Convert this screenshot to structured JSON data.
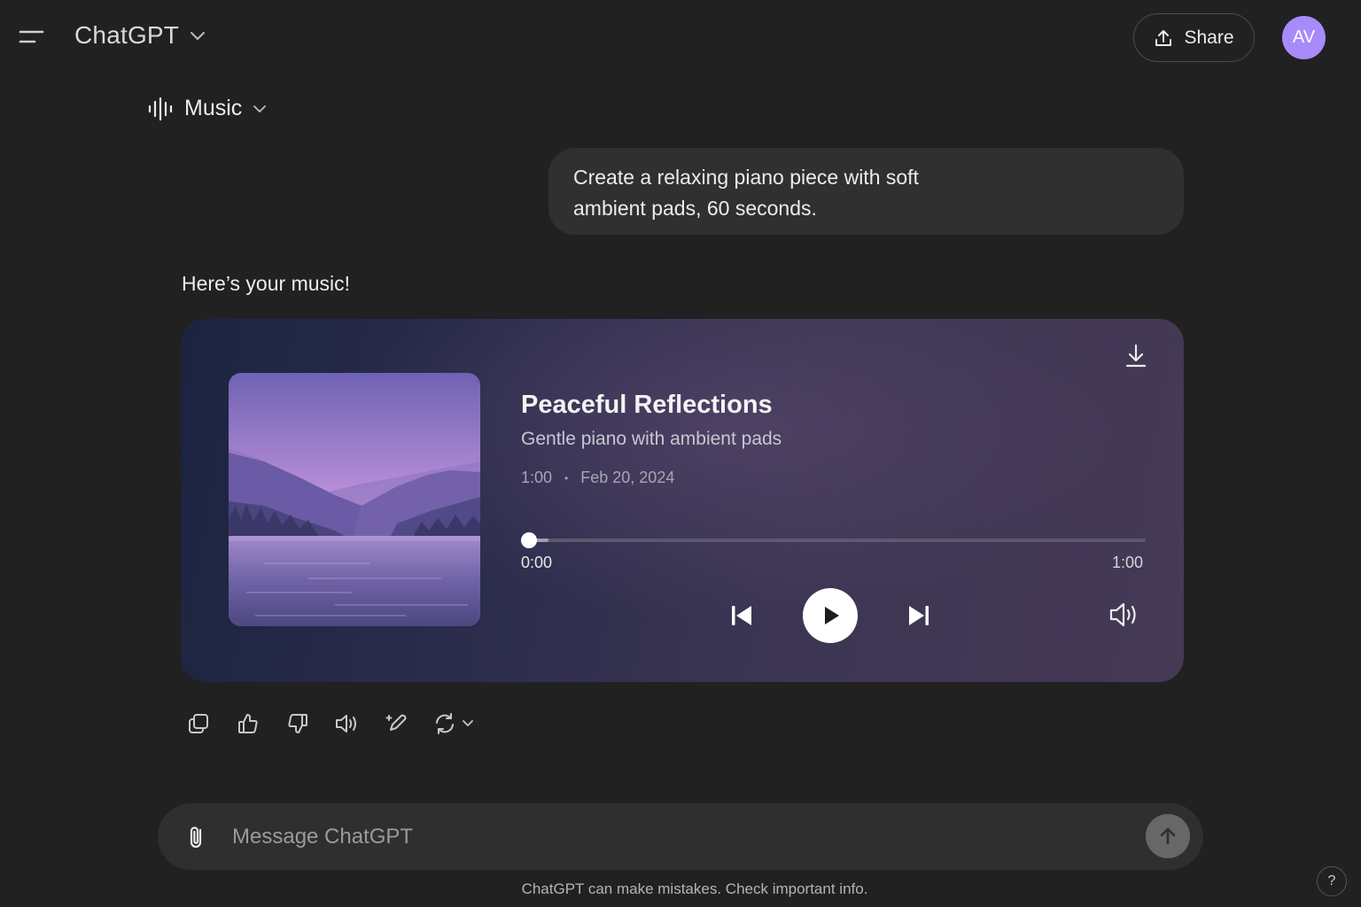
{
  "header": {
    "app_title": "ChatGPT",
    "share_label": "Share",
    "avatar_initials": "AV",
    "avatar_color": "#a78bfa"
  },
  "model_selector": {
    "label": "Music",
    "icon": "waveform-icon"
  },
  "conversation": {
    "user_message_lines": [
      "Create a relaxing piano piece with soft",
      "ambient pads, 60 seconds."
    ],
    "assistant_intro": "Here’s your music!"
  },
  "music_card": {
    "title": "Peaceful Reflections",
    "subtitle": "Gentle piano with ambient pads",
    "duration": "1:00",
    "date": "Feb 20, 2024",
    "progress": 0.0,
    "time_current": "0:00",
    "time_total": "1:00",
    "icons": [
      "download-icon",
      "skip-previous-icon",
      "play-icon",
      "skip-next-icon",
      "volume-icon"
    ]
  },
  "actions": {
    "icons": [
      "copy-icon",
      "thumbs-up-icon",
      "thumbs-down-icon",
      "read-aloud-icon",
      "edit-icon",
      "regenerate-icon"
    ]
  },
  "composer": {
    "placeholder": "Message ChatGPT",
    "value": ""
  },
  "footer": {
    "disclaimer": "ChatGPT can make mistakes. Check important info.",
    "help_label": "?"
  }
}
